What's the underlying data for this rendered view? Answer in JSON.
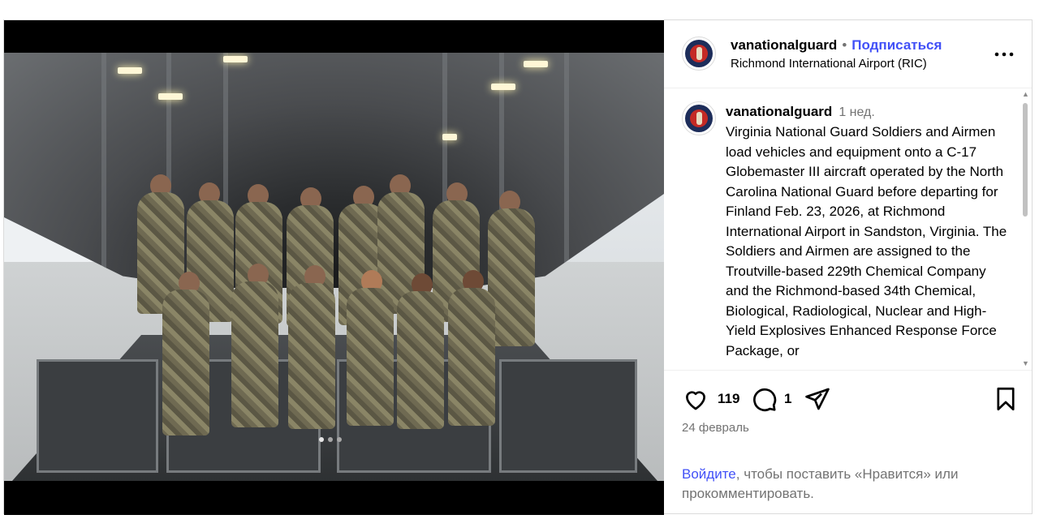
{
  "post": {
    "header": {
      "username": "vanationalguard",
      "separator": "•",
      "follow_label": "Подписаться",
      "location": "Richmond International Airport (RIC)",
      "more_label": "•••"
    },
    "caption": {
      "username": "vanationalguard",
      "time": "1 нед.",
      "text": "Virginia National Guard Soldiers and Airmen load vehicles and equipment onto a C-17 Globemaster III aircraft operated by the North Carolina National Guard before departing for Finland Feb. 23, 2026, at Richmond International Airport in Sandston, Virginia. The Soldiers and Airmen are assigned to the Troutville-based 229th Chemical Company and the Richmond-based 34th Chemical, Biological, Radiological, Nuclear and High-Yield Explosives Enhanced Response Force Package, or"
    },
    "actions": {
      "likes_count": "119",
      "comments_count": "1"
    },
    "date": "24 февраль",
    "login_prompt": {
      "link_text": "Войдите",
      "rest_text": ", чтобы поставить «Нравится» или прокомментировать."
    },
    "media": {
      "carousel_dots": 3,
      "active_dot": 0
    }
  },
  "icons": {
    "like": "heart-icon",
    "comment": "comment-icon",
    "share": "share-icon",
    "save": "bookmark-icon",
    "more": "more-options-icon"
  },
  "colors": {
    "accent_link": "#4150f7",
    "muted_text": "#737373",
    "border": "#dbdbdb"
  }
}
